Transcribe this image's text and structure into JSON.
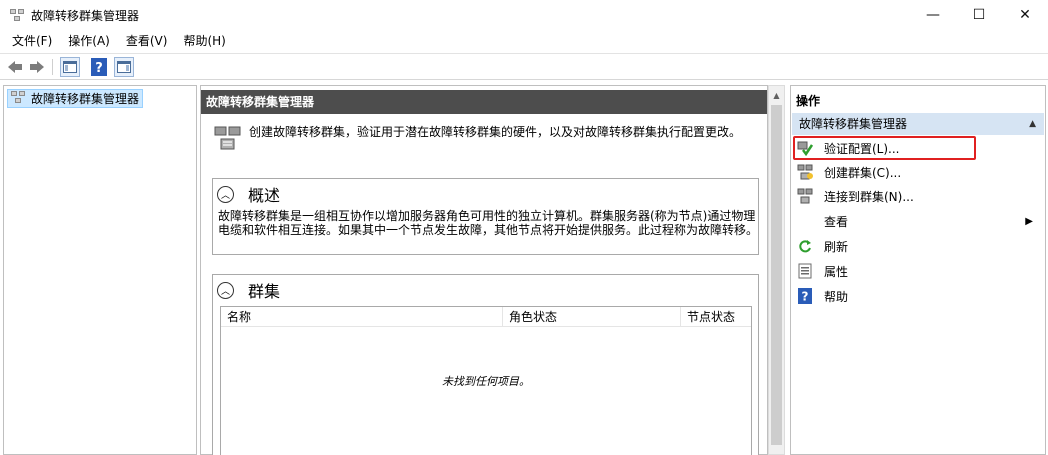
{
  "window": {
    "title": "故障转移群集管理器",
    "controls": {
      "minimize": "—",
      "maximize": "☐",
      "close": "✕"
    }
  },
  "menubar": {
    "items": [
      "文件(F)",
      "操作(A)",
      "查看(V)",
      "帮助(H)"
    ]
  },
  "tree": {
    "root_label": "故障转移群集管理器"
  },
  "center": {
    "header": "故障转移群集管理器",
    "description": "创建故障转移群集，验证用于潜在故障转移群集的硬件，以及对故障转移群集执行配置更改。",
    "overview": {
      "title": "概述",
      "text": "故障转移群集是一组相互协作以增加服务器角色可用性的独立计算机。群集服务器(称为节点)通过物理电缆和软件相互连接。如果其中一个节点发生故障，其他节点将开始提供服务。此过程称为故障转移。"
    },
    "clusters": {
      "title": "群集",
      "columns": [
        "名称",
        "角色状态",
        "节点状态"
      ],
      "empty_text": "未找到任何项目。"
    }
  },
  "actions": {
    "title": "操作",
    "group_label": "故障转移群集管理器",
    "items": [
      {
        "label": "验证配置(L)...",
        "icon": "validate-icon"
      },
      {
        "label": "创建群集(C)...",
        "icon": "create-cluster-icon"
      },
      {
        "label": "连接到群集(N)...",
        "icon": "connect-cluster-icon"
      },
      {
        "label": "查看",
        "icon": "none"
      },
      {
        "label": "刷新",
        "icon": "refresh-icon"
      },
      {
        "label": "属性",
        "icon": "properties-icon"
      },
      {
        "label": "帮助",
        "icon": "help-icon"
      }
    ]
  },
  "colors": {
    "center_header_bg": "#4d4d4d",
    "action_group_bg": "#d6e4f3",
    "tree_selection_bg": "#cce8ff",
    "highlight_border": "#e02020"
  }
}
